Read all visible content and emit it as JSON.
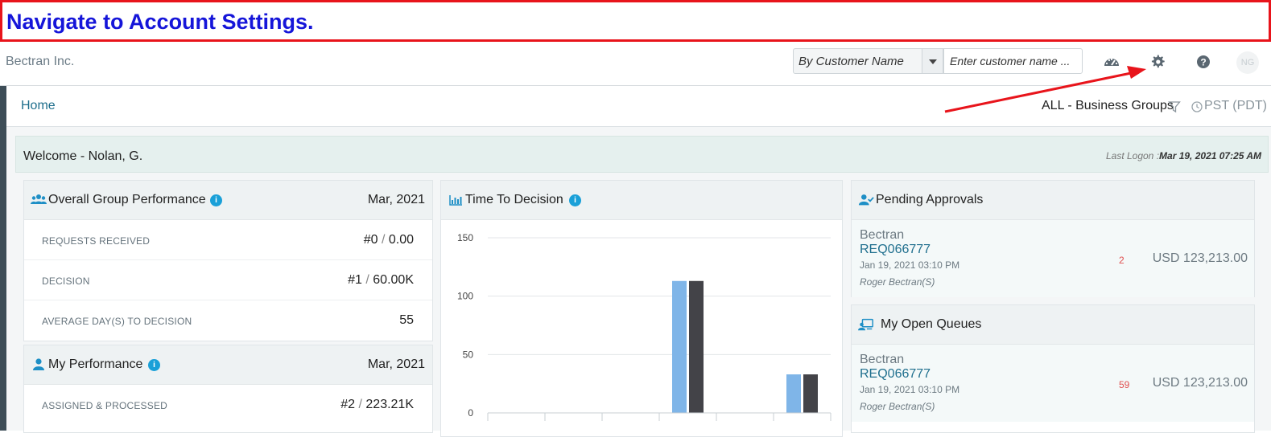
{
  "instruction": "Navigate to Account Settings.",
  "header": {
    "brand": "Bectran Inc.",
    "search_mode": "By Customer Name",
    "search_placeholder": "Enter customer name ...",
    "icons": [
      "dashboard-gauge-icon",
      "gear-icon",
      "help-icon"
    ],
    "avatar_initials": "NG"
  },
  "breadcrumb": {
    "home": "Home",
    "business_groups": "ALL - Business Groups",
    "timezone": "PST (PDT)"
  },
  "welcome": {
    "title": "Welcome - Nolan, G.",
    "last_logon_label": "Last Logon :",
    "last_logon_value": "Mar 19, 2021 07:25 AM"
  },
  "group_performance": {
    "title": "Overall Group Performance",
    "date": "Mar, 2021",
    "rows": [
      {
        "label": "REQUESTS RECEIVED",
        "count": "#0",
        "amount": "0.00"
      },
      {
        "label": "DECISION",
        "count": "#1",
        "amount": "60.00K"
      },
      {
        "label": "AVERAGE DAY(S) TO DECISION",
        "value": "55"
      }
    ]
  },
  "my_performance": {
    "title": "My Performance",
    "date": "Mar, 2021",
    "rows": [
      {
        "label": "ASSIGNED & PROCESSED",
        "count": "#2",
        "amount": "223.21K"
      }
    ]
  },
  "time_to_decision": {
    "title": "Time To Decision"
  },
  "pending_approvals": {
    "title": "Pending Approvals",
    "item": {
      "company": "Bectran",
      "request": "REQ066777",
      "date": "Jan 19, 2021 03:10 PM",
      "user": "Roger Bectran(S)",
      "count": "2",
      "amount": "USD 123,213.00"
    }
  },
  "open_queues": {
    "title": "My Open Queues",
    "item": {
      "company": "Bectran",
      "request": "REQ066777",
      "date": "Jan 19, 2021 03:10 PM",
      "user": "Roger Bectran(S)",
      "count": "59",
      "amount": "USD 123,213.00"
    }
  },
  "colors": {
    "series_light": "#7fb5e8",
    "series_dark": "#434348",
    "accent": "#1aa0d8",
    "annotation_arrow": "#e8141b"
  },
  "chart_data": {
    "type": "bar",
    "title": "Time To Decision",
    "categories": [
      "",
      "",
      "",
      "",
      "",
      ""
    ],
    "series": [
      {
        "values": [
          0,
          0,
          0,
          113,
          0,
          33
        ]
      },
      {
        "values": [
          0,
          0,
          0,
          113,
          0,
          33
        ]
      }
    ],
    "ylim": [
      0,
      150
    ],
    "yticks": [
      "0",
      "50",
      "100",
      "150"
    ],
    "grid": true
  }
}
